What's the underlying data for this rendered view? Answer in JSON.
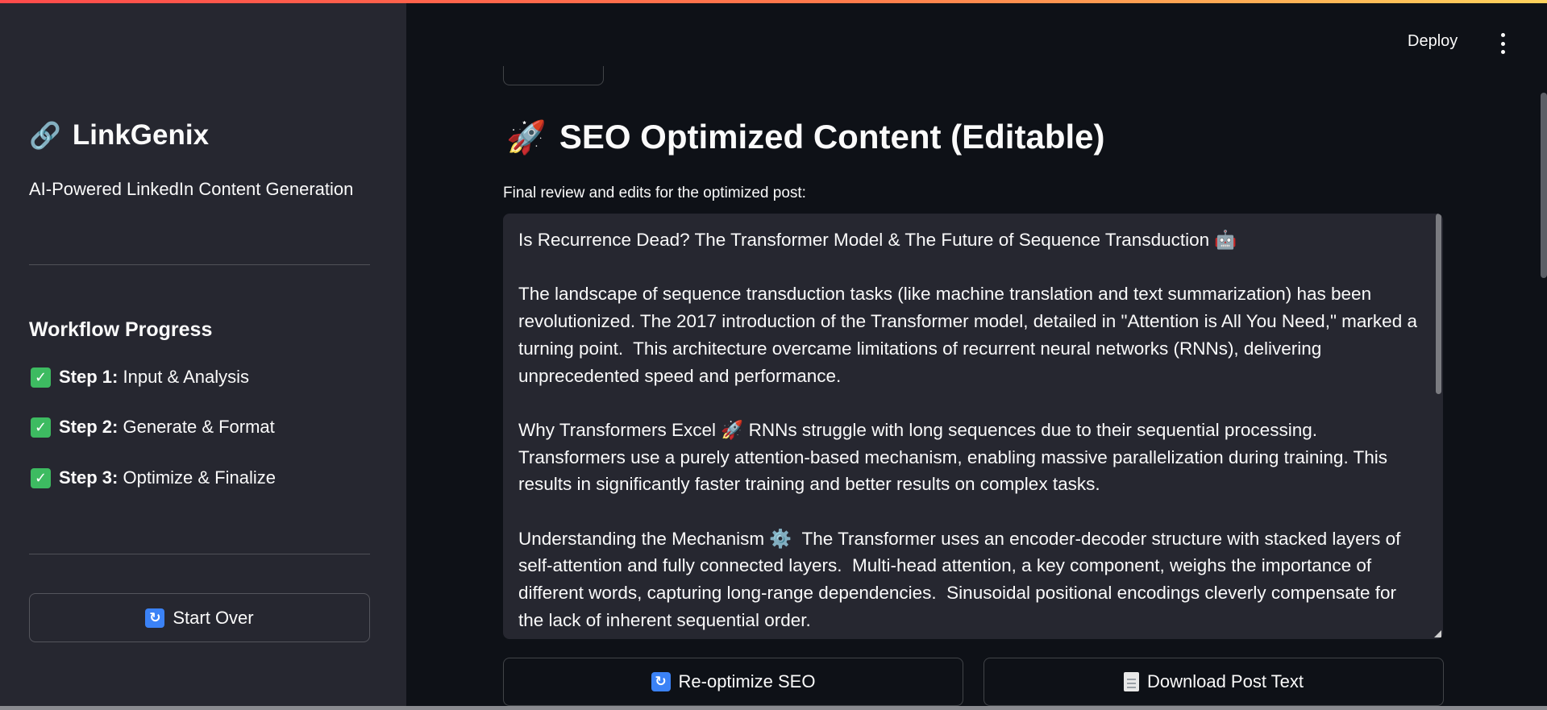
{
  "app": {
    "deploy_label": "Deploy",
    "accent_gradient": [
      "#ff4b4b",
      "#ffd35c"
    ]
  },
  "sidebar": {
    "brand_icon": "🔗",
    "brand_name": "LinkGenix",
    "tagline": "AI-Powered LinkedIn Content Generation",
    "workflow_title": "Workflow Progress",
    "steps": [
      {
        "label": "Step 1:",
        "text": "Input & Analysis",
        "icon": "check-icon"
      },
      {
        "label": "Step 2:",
        "text": "Generate & Format",
        "icon": "check-icon"
      },
      {
        "label": "Step 3:",
        "text": "Optimize & Finalize",
        "icon": "check-icon"
      }
    ],
    "start_over_label": "Start Over"
  },
  "main": {
    "title_icon": "🚀",
    "title": "SEO Optimized Content (Editable)",
    "field_label": "Final review and edits for the optimized post:",
    "post_paragraphs": [
      "Is Recurrence Dead? The Transformer Model & The Future of Sequence Transduction 🤖",
      "The landscape of sequence transduction tasks (like machine translation and text summarization) has been revolutionized. The 2017 introduction of the Transformer model, detailed in \"Attention is All You Need,\" marked a turning point.  This architecture overcame limitations of recurrent neural networks (RNNs), delivering unprecedented speed and performance.",
      "Why Transformers Excel 🚀 RNNs struggle with long sequences due to their sequential processing. Transformers use a purely attention-based mechanism, enabling massive parallelization during training. This results in significantly faster training and better results on complex tasks.",
      "Understanding the Mechanism ⚙️  The Transformer uses an encoder-decoder structure with stacked layers of self-attention and fully connected layers.  Multi-head attention, a key component, weighs the importance of different words, capturing long-range dependencies.  Sinusoidal positional encodings cleverly compensate for the lack of inherent sequential order."
    ],
    "reoptimize_label": "Re-optimize SEO",
    "download_label": "Download Post Text"
  }
}
